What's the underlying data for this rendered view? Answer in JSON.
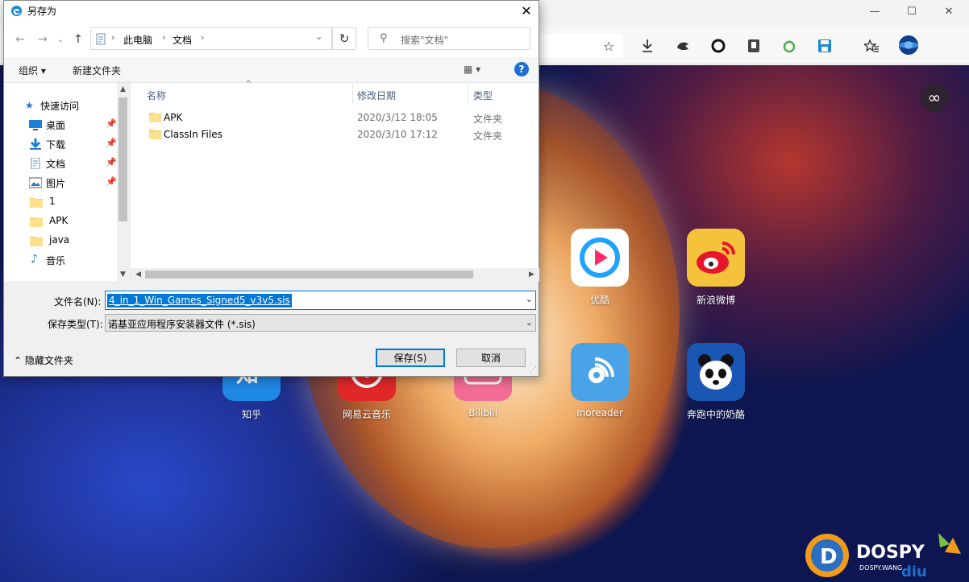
{
  "browser": {
    "window_controls": {
      "minimize": "—",
      "maximize": "☐",
      "close": "✕"
    },
    "toolbar_icons": [
      "favorite-star-icon",
      "download-icon",
      "sync-icon",
      "record-icon",
      "shield-extension-icon",
      "refresh-extension-icon",
      "save-extension-icon",
      "favorites-list-icon",
      "profile-avatar-icon"
    ]
  },
  "newtab": {
    "apps": [
      {
        "label": "优酷",
        "color": "#ffffff"
      },
      {
        "label": "新浪微博",
        "color": "#f5c33b"
      },
      {
        "label": "知乎",
        "color": "#1e88e5"
      },
      {
        "label": "网易云音乐",
        "color": "#e02828"
      },
      {
        "label": "Bilibili",
        "color": "#f36c95"
      },
      {
        "label": "Inoreader",
        "color": "#4aa3e6"
      },
      {
        "label": "奔跑中的奶酪",
        "color": "#1a56b4"
      }
    ],
    "watermark": {
      "brand": "DOSPY",
      "sub": "DOSPY.WANG",
      "badge": "diu"
    }
  },
  "dialog": {
    "title": "另存为",
    "path": [
      "此电脑",
      "文档"
    ],
    "search_placeholder": "搜索\"文档\"",
    "organize": "组织",
    "new_folder": "新建文件夹",
    "tree": [
      {
        "label": "快速访问",
        "icon": "star-icon",
        "pinned": false
      },
      {
        "label": "桌面",
        "icon": "desktop-icon",
        "pinned": true
      },
      {
        "label": "下载",
        "icon": "download-folder-icon",
        "pinned": true
      },
      {
        "label": "文档",
        "icon": "document-icon",
        "pinned": true
      },
      {
        "label": "图片",
        "icon": "pictures-icon",
        "pinned": true
      },
      {
        "label": "1",
        "icon": "folder-icon",
        "pinned": false
      },
      {
        "label": "APK",
        "icon": "folder-icon",
        "pinned": false
      },
      {
        "label": "java",
        "icon": "folder-icon",
        "pinned": false
      },
      {
        "label": "音乐",
        "icon": "music-icon",
        "pinned": false
      }
    ],
    "columns": {
      "name": "名称",
      "date": "修改日期",
      "type": "类型"
    },
    "files": [
      {
        "name": "APK",
        "date": "2020/3/12 18:05",
        "type": "文件夹"
      },
      {
        "name": "ClassIn Files",
        "date": "2020/3/10 17:12",
        "type": "文件夹"
      }
    ],
    "filename_label": "文件名(N):",
    "filename_value": "4_in_1_Win_Games_Signed5_v3v5.sis",
    "filetype_label": "保存类型(T):",
    "filetype_value": "诺基亚应用程序安装器文件 (*.sis)",
    "hide_folders": "隐藏文件夹",
    "save_button": "保存(S)",
    "cancel_button": "取消"
  }
}
